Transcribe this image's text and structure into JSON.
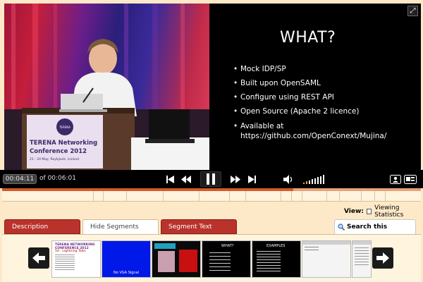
{
  "slide": {
    "title": "WHAT?",
    "bullets": [
      "Mock IDP/SP",
      "Built upon OpenSAML",
      "Configure using REST API",
      "Open Source (Apache 2 licence)",
      "Available at https://github.com/OpenConext/Mujina/"
    ]
  },
  "camera": {
    "banner_line1": "TERENA Networking",
    "banner_line2": "Conference 2012",
    "banner_line3": "21 - 24 May, Reykjavík, Iceland",
    "logo_text": "TERENA"
  },
  "player": {
    "current_time": "00:04:11",
    "total_prefix": "of",
    "total_time": "00:06:01",
    "progress": 0.695,
    "icons": [
      "fullscreen-icon",
      "skip-back-icon",
      "rewind-icon",
      "pause-icon",
      "fast-forward-icon",
      "skip-forward-icon",
      "volume-icon",
      "presenter-layout-icon",
      "slides-layout-icon"
    ]
  },
  "view": {
    "label": "View:",
    "stats_label": "Viewing Statistics",
    "stats_checked": false
  },
  "tabs": [
    {
      "label": "Description",
      "active": false
    },
    {
      "label": "Hide Segments",
      "active": true
    },
    {
      "label": "Segment Text",
      "active": false
    }
  ],
  "search": {
    "label": "Search this recording",
    "icon": "magnifier-icon"
  },
  "thumbnails": [
    {
      "kind": "title-slide",
      "title": "TERENA NETWORKING CONFERENCE 2012",
      "subtitle": "5A - Lightning Talks"
    },
    {
      "kind": "no-signal",
      "text": "No VGA Signal"
    },
    {
      "kind": "image-slide"
    },
    {
      "kind": "bullet-slide",
      "title": "WHAT?"
    },
    {
      "kind": "bullet-slide",
      "title": "EXAMPLES"
    },
    {
      "kind": "browser"
    },
    {
      "kind": "browser"
    }
  ],
  "colors": {
    "page_bg": "#fde9c8",
    "tab_red": "#b9322b",
    "progress": "#d05a2a",
    "volume_active": "#f0a030"
  }
}
